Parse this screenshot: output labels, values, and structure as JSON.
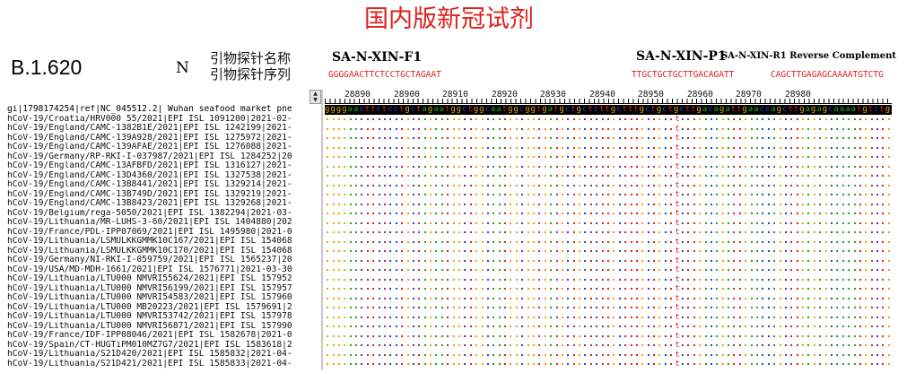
{
  "header": {
    "title": "国内版新冠试剂",
    "lineage": "B.1.620",
    "gene": "N",
    "probe_name_label": "引物探针名称",
    "probe_seq_label": "引物探针序列"
  },
  "probes": [
    {
      "name": "SA-N-XIN-F1",
      "seq": "GGGGAACTTCTCCTGCTAGAAT"
    },
    {
      "name": "SA-N-XIN-P1",
      "seq": "TTGCTGCTGCTTGACAGATT"
    },
    {
      "name": "SA-N-XIN-R1 Reverse Complement",
      "seq": "CAGCTTGAGAGCAAAATGTCTG"
    }
  ],
  "ruler": {
    "labels": [
      "28890",
      "28900",
      "28910",
      "28920",
      "28930",
      "28940",
      "28950",
      "28960",
      "28970",
      "28980"
    ]
  },
  "reference_sequence": "ggggaacttctcctgctagaatggctggcaatggcggtgatgctgctcttgctttgctgctgcttgacagattgaaccagcttgagagcaaaatgtctg",
  "mutation": {
    "column": 61,
    "base": "t"
  },
  "sequences": [
    "gi|1798174254|ref|NC_045512.2| Wuhan seafood market pne",
    "hCoV-19/Croatia/HRV000 55/2021|EPI ISL 1091200|2021-02-",
    "hCoV-19/England/CAMC-1382B1E/2021|EPI ISL 1242199|2021-",
    "hCoV-19/England/CAMC-139A928/2021|EPI ISL 1275972|2021-",
    "hCoV-19/England/CAMC-139AFAE/2021|EPI ISL 1276088|2021-",
    "hCoV-19/Germany/RP-RKI-I-037987/2021|EPI ISL 1284252|20",
    "hCoV-19/England/CAMC-13AFBFD/2021|EPI ISL 1316127|2021-",
    "hCoV-19/England/CAMC-13D4360/2021|EPI ISL 1327538|2021-",
    "hCoV-19/England/CAMC-13B8441/2021|EPI ISL 1329214|2021-",
    "hCoV-19/England/CAMC-13B749D/2021|EPI ISL 1329219|2021-",
    "hCoV-19/England/CAMC-13B8423/2021|EPI ISL 1329268|2021-",
    "hCoV-19/Belgium/rega-5050/2021|EPI ISL 1382294|2021-03-",
    "hCoV-19/Lithuania/MR-LUHS-3-60/2021|EPI ISL 1404880|202",
    "hCoV-19/France/PDL-IPP07069/2021|EPI ISL 1495980|2021-0",
    "hCoV-19/Lithuania/LSMULKKGMMK10C167/2021|EPI ISL 154068",
    "hCoV-19/Lithuania/LSMULKKGMMK10C170/2021|EPI ISL 154068",
    "hCoV-19/Germany/NI-RKI-I-059759/2021|EPI ISL 1565237|20",
    "hCoV-19/USA/MD-MDH-1661/2021|EPI ISL 1576771|2021-03-30",
    "hCoV-19/Lithuania/LTU000 NMVRI55624/2021|EPI ISL 157952",
    "hCoV-19/Lithuania/LTU000 NMVRI56199/2021|EPI ISL 157957",
    "hCoV-19/Lithuania/LTU000 NMVRI54583/2021|EPI ISL 157960",
    "hCoV-19/Lithuania/LTU000 MB20223/2021|EPI ISL 1579691|2",
    "hCoV-19/Lithuania/LTU000 NMVRI53742/2021|EPI ISL 157978",
    "hCoV-19/Lithuania/LTU000 NMVRI56871/2021|EPI ISL 157990",
    "hCoV-19/France/IDF-IPP08046/2021|EPI ISL 1582678|2021-0",
    "hCoV-19/Spain/CT-HUGTiPM010MZ7G7/2021|EPI ISL 1583618|2",
    "hCoV-19/Lithuania/S21D420/2021|EPI ISL 1585832|2021-04-",
    "hCoV-19/Lithuania/S21D421/2021|EPI ISL 1585833|2021-04-"
  ],
  "colors": {
    "title": "#e0201c",
    "a": "#1fa51f",
    "c": "#2f3fe0",
    "g": "#e8a800",
    "t": "#e02020"
  }
}
